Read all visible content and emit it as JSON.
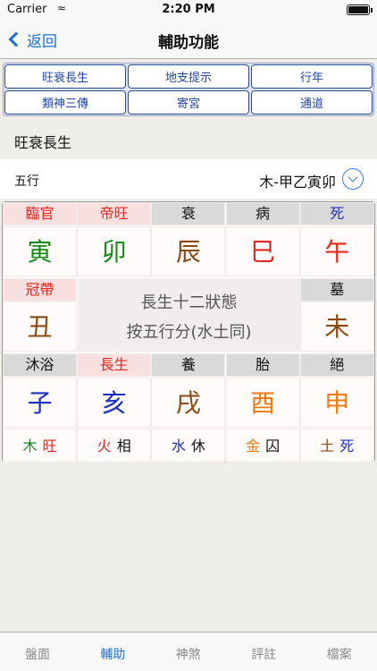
{
  "status": {
    "carrier": "Carrier",
    "time": "2:20 PM"
  },
  "nav": {
    "back_label": "返回",
    "title": "輔助功能"
  },
  "segments": [
    "旺衰長生",
    "地支提示",
    "行年",
    "類神三傳",
    "寄宮",
    "通道"
  ],
  "section_title": "旺衰長生",
  "element_row": {
    "label": "五行",
    "value": "木-甲乙寅卯"
  },
  "colors": {
    "red": "#e0281e",
    "green": "#148a14",
    "brown": "#8b4a12",
    "blue": "#1b2ec2",
    "orange": "#f07a10",
    "black": "#111111"
  },
  "board": {
    "top_headers": [
      {
        "text": "臨官",
        "color": "#e0281e",
        "bg": "pink"
      },
      {
        "text": "帝旺",
        "color": "#e0281e",
        "bg": "pink"
      },
      {
        "text": "衰",
        "color": "#111111",
        "bg": "gray"
      },
      {
        "text": "病",
        "color": "#111111",
        "bg": "gray"
      },
      {
        "text": "死",
        "color": "#1b2ec2",
        "bg": "gray"
      }
    ],
    "top_branches": [
      {
        "text": "寅",
        "color": "#148a14"
      },
      {
        "text": "卯",
        "color": "#148a14"
      },
      {
        "text": "辰",
        "color": "#8b4a12"
      },
      {
        "text": "巳",
        "color": "#e0281e"
      },
      {
        "text": "午",
        "color": "#e0281e"
      }
    ],
    "left_header": {
      "text": "冠帶",
      "color": "#e0281e",
      "bg": "pink"
    },
    "left_branch": {
      "text": "丑",
      "color": "#8b4a12"
    },
    "right_header": {
      "text": "墓",
      "color": "#111111",
      "bg": "gray"
    },
    "right_branch": {
      "text": "未",
      "color": "#8b4a12"
    },
    "center_line1": "長生十二狀態",
    "center_line2": "按五行分(水土同)",
    "bottom_headers": [
      {
        "text": "沐浴",
        "color": "#111111",
        "bg": "gray"
      },
      {
        "text": "長生",
        "color": "#e0281e",
        "bg": "pink"
      },
      {
        "text": "養",
        "color": "#111111",
        "bg": "gray"
      },
      {
        "text": "胎",
        "color": "#111111",
        "bg": "gray"
      },
      {
        "text": "絕",
        "color": "#111111",
        "bg": "gray"
      }
    ],
    "bottom_branches": [
      {
        "text": "子",
        "color": "#1b2ec2"
      },
      {
        "text": "亥",
        "color": "#1b2ec2"
      },
      {
        "text": "戌",
        "color": "#8b4a12"
      },
      {
        "text": "酉",
        "color": "#f07a10"
      },
      {
        "text": "申",
        "color": "#f07a10"
      }
    ],
    "elements": [
      {
        "element": "木",
        "element_color": "#148a14",
        "state": "旺",
        "state_color": "#e0281e"
      },
      {
        "element": "火",
        "element_color": "#e0281e",
        "state": "相",
        "state_color": "#111111"
      },
      {
        "element": "水",
        "element_color": "#1b2ec2",
        "state": "休",
        "state_color": "#111111"
      },
      {
        "element": "金",
        "element_color": "#f07a10",
        "state": "囚",
        "state_color": "#111111"
      },
      {
        "element": "土",
        "element_color": "#8b4a12",
        "state": "死",
        "state_color": "#1b2ec2"
      }
    ]
  },
  "tabs": [
    {
      "label": "盤面",
      "active": false
    },
    {
      "label": "輔助",
      "active": true
    },
    {
      "label": "神煞",
      "active": false
    },
    {
      "label": "評註",
      "active": false
    },
    {
      "label": "檔案",
      "active": false
    }
  ]
}
